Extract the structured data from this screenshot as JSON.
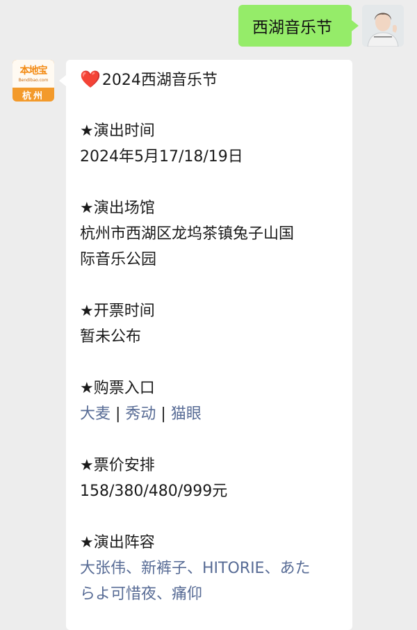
{
  "user_message": "西湖音乐节",
  "bot_avatar": {
    "logo": "本地宝",
    "site": "Bendibao.com",
    "city": "杭州"
  },
  "reply": {
    "title": "2024西湖音乐节",
    "time_header": "★演出时间",
    "time_value": "2024年5月17/18/19日",
    "venue_header": "★演出场馆",
    "venue_line1": "杭州市西湖区龙坞茶镇兔子山国",
    "venue_line2": "际音乐公园",
    "ticket_time_header": "★开票时间",
    "ticket_time_value": "暂未公布",
    "purchase_header": "★购票入口",
    "purchase_links": [
      "大麦",
      "秀动",
      "猫眼"
    ],
    "purchase_separator": " | ",
    "price_header": "★票价安排",
    "price_value": "158/380/480/999元",
    "lineup_header": "★演出阵容",
    "lineup_line1": "大张伟、新裤子、HITORIE、あた",
    "lineup_line2": "らよ可惜夜、痛仰"
  },
  "icons": {
    "heart": "heart-icon",
    "user_avatar": "user-avatar",
    "bot_avatar": "bendibao-avatar"
  },
  "colors": {
    "outgoing_bubble": "#95ec69",
    "link": "#576b95",
    "background": "#ededed",
    "heart": "#e5282f"
  }
}
